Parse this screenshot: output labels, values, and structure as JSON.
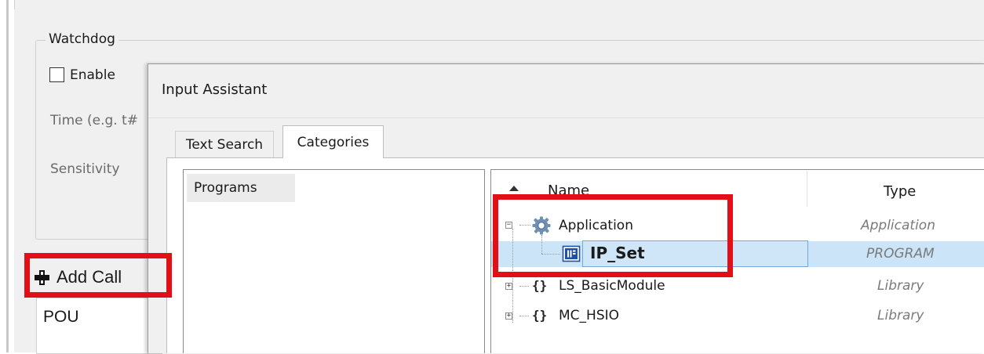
{
  "settings": {
    "watchdog_title": "Watchdog",
    "enable_label": "Enable",
    "time_label": "Time (e.g. t#",
    "sensitivity_label": "Sensitivity",
    "add_call_label": "Add Call",
    "pou_label": "POU"
  },
  "dialog": {
    "title": "Input Assistant",
    "tabs": [
      {
        "label": "Text Search"
      },
      {
        "label": "Categories"
      }
    ],
    "categories": [
      {
        "label": "Programs"
      }
    ],
    "tree": {
      "columns": {
        "name": "Name",
        "type": "Type"
      },
      "rows": [
        {
          "name": "Application",
          "type": "Application"
        },
        {
          "name": "IP_Set",
          "type": "PROGRAM"
        },
        {
          "name": "LS_BasicModule",
          "type": "Library"
        },
        {
          "name": "MC_HSIO",
          "type": "Library"
        }
      ],
      "library_icon": "{}"
    }
  },
  "colors": {
    "highlight_red": "#e30f16",
    "selection_blue": "#cce4f7"
  },
  "icons": [
    "plus-icon",
    "gear-icon",
    "program-icon",
    "library-icon",
    "sort-up-icon",
    "expand-icon",
    "collapse-icon"
  ]
}
